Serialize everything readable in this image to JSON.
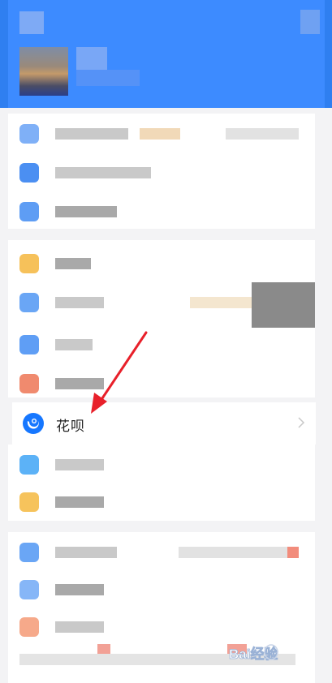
{
  "huabei": {
    "label": "花呗"
  },
  "watermark": {
    "text": "Bai经验"
  },
  "colors": {
    "header_blue": "#3d8bff",
    "accent_blue": "#1677ff",
    "arrow_red": "#e8202a"
  },
  "icons": {
    "huabei": "huabei-logo-icon",
    "chevron": "chevron-right-icon"
  }
}
